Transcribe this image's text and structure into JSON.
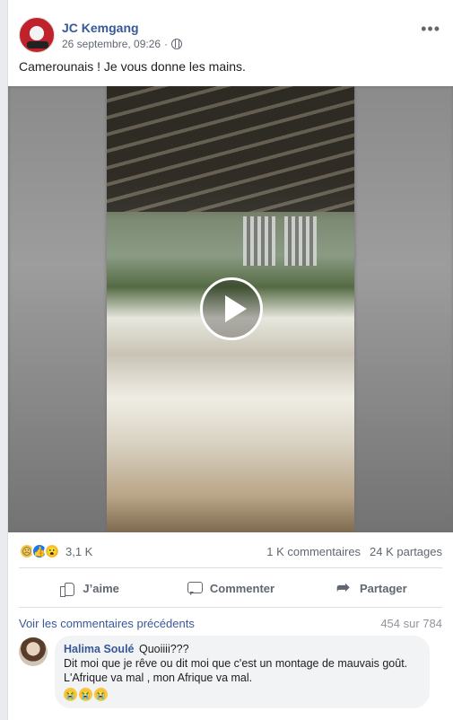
{
  "post": {
    "author": "JC Kemgang",
    "timestamp": "26 septembre, 09:26",
    "privacy_icon": "globe-icon",
    "more_icon": "•••",
    "text": "Camerounais ! Je vous donne les mains."
  },
  "video": {
    "play_icon": "play-icon"
  },
  "stats": {
    "reactions": [
      "sad",
      "like",
      "wow"
    ],
    "reaction_count": "3,1 K",
    "comments": "1 K commentaires",
    "shares": "24 K partages"
  },
  "actions": {
    "like": "J’aime",
    "comment": "Commenter",
    "share": "Partager"
  },
  "comments_section": {
    "previous_link": "Voir les commentaires précédents",
    "count": "454 sur 784",
    "comment": {
      "name": "Halima Soulé",
      "text_line1": "Quoiiii???",
      "text_line2": "Dit moi que je rêve ou dit moi que c'est un montage de mauvais goût.",
      "text_line3": "L'Afrique va mal , mon Afrique va mal.",
      "emojis": [
        "😭",
        "😭",
        "😭"
      ]
    }
  },
  "colors": {
    "link": "#385898",
    "muted": "#606770",
    "background": "#e9ebee",
    "bubble": "#f2f3f5"
  }
}
